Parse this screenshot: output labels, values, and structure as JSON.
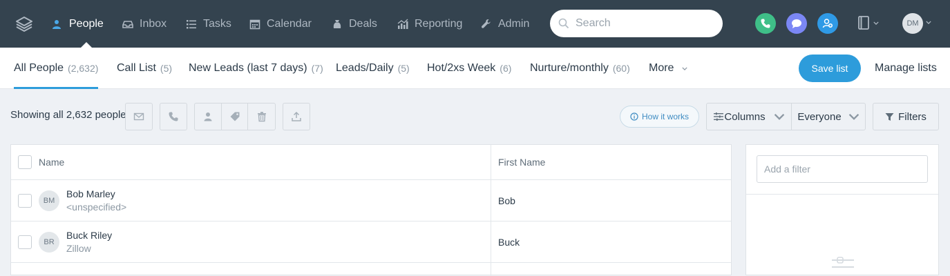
{
  "nav": {
    "items": [
      {
        "label": "People",
        "icon": "person-icon"
      },
      {
        "label": "Inbox",
        "icon": "inbox-icon"
      },
      {
        "label": "Tasks",
        "icon": "list-icon"
      },
      {
        "label": "Calendar",
        "icon": "calendar-icon"
      },
      {
        "label": "Deals",
        "icon": "money-bag-icon"
      },
      {
        "label": "Reporting",
        "icon": "chart-icon"
      },
      {
        "label": "Admin",
        "icon": "wrench-icon"
      }
    ],
    "active": "People",
    "search_placeholder": "Search",
    "user_initials": "DM"
  },
  "lists": {
    "tabs": [
      {
        "label": "All People",
        "count": "(2,632)"
      },
      {
        "label": "Call List",
        "count": "(5)"
      },
      {
        "label": "New Leads (last 7 days)",
        "count": "(7)"
      },
      {
        "label": "Leads/Daily",
        "count": "(5)"
      },
      {
        "label": "Hot/2xs Week",
        "count": "(6)"
      },
      {
        "label": "Nurture/monthly",
        "count": "(60)"
      }
    ],
    "more_label": "More",
    "save_label": "Save list",
    "manage_label": "Manage lists"
  },
  "toolbar": {
    "showing_text": "Showing all 2,632 people",
    "how_it_works": "How it works",
    "columns_label": "Columns",
    "owner_filter": "Everyone",
    "filters_label": "Filters"
  },
  "table": {
    "headers": {
      "name": "Name",
      "first_name": "First Name"
    },
    "rows": [
      {
        "initials": "BM",
        "name": "Bob Marley",
        "sub": "<unspecified>",
        "first_name": "Bob"
      },
      {
        "initials": "BR",
        "name": "Buck Riley",
        "sub": "Zillow",
        "first_name": "Buck"
      }
    ]
  },
  "filter_panel": {
    "placeholder": "Add a filter"
  },
  "colors": {
    "topbar": "#34434f",
    "accent": "#2d9cdb",
    "phone_green": "#3fbf88",
    "chat_purple": "#7b87f5",
    "contact_blue": "#2f9ae6"
  }
}
